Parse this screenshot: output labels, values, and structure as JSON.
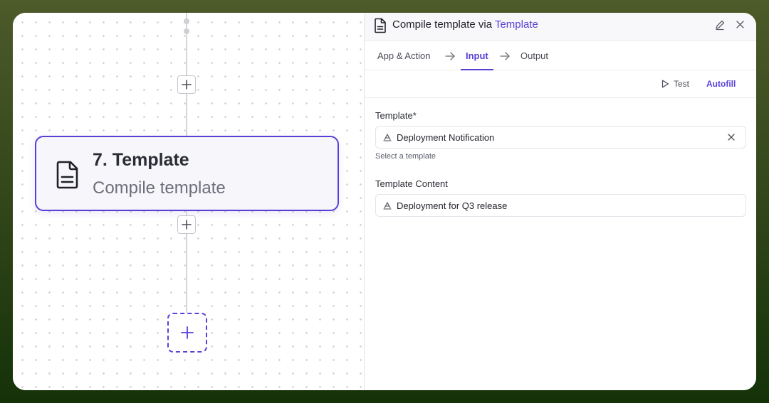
{
  "canvas": {
    "node": {
      "title": "7. Template",
      "subtitle": "Compile template"
    }
  },
  "panel": {
    "header": {
      "title_prefix": "Compile template via",
      "title_app": "Template"
    },
    "tabs": [
      {
        "label": "App & Action",
        "active": false
      },
      {
        "label": "Input",
        "active": true
      },
      {
        "label": "Output",
        "active": false
      }
    ],
    "toolbar": {
      "test_label": "Test",
      "autofill_label": "Autofill"
    },
    "fields": {
      "template": {
        "label": "Template*",
        "value": "Deployment Notification",
        "helper": "Select a template"
      },
      "content": {
        "label": "Template Content",
        "value": "Deployment for Q3 release"
      }
    }
  },
  "colors": {
    "accent": "#5a3fd6",
    "border": "#e3e4ea",
    "text": "#1f2128"
  },
  "icons": [
    "document-icon",
    "plus-icon",
    "edit-icon",
    "close-icon",
    "arrow-right-icon",
    "play-icon",
    "text-type-icon"
  ]
}
